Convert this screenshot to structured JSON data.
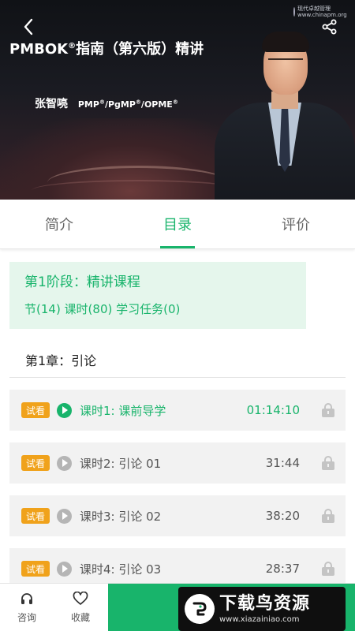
{
  "hero": {
    "title_main": "PMBOK",
    "title_sup": "®",
    "title_rest": "指南（第六版）精讲",
    "author_name": "张智喨",
    "author_creds": [
      {
        "text": "PMP",
        "sup": "®"
      },
      {
        "text": "/PgMP",
        "sup": "®"
      },
      {
        "text": "/OPME",
        "sup": "®"
      }
    ],
    "logo_line1": "现代卓越管理",
    "logo_line2": "www.chinapm.org"
  },
  "tabs": [
    {
      "label": "简介",
      "active": false
    },
    {
      "label": "目录",
      "active": true
    },
    {
      "label": "评价",
      "active": false
    }
  ],
  "stage": {
    "title": "第1阶段：精讲课程",
    "meta": "节(14) 课时(80) 学习任务(0)"
  },
  "chapter": {
    "title": "第1章：引论"
  },
  "lessons": [
    {
      "badge": "试看",
      "name": "课时1: 课前导学",
      "duration": "01:14:10",
      "active": true
    },
    {
      "badge": "试看",
      "name": "课时2: 引论 01",
      "duration": "31:44",
      "active": false
    },
    {
      "badge": "试看",
      "name": "课时3: 引论 02",
      "duration": "38:20",
      "active": false
    },
    {
      "badge": "试看",
      "name": "课时4: 引论 03",
      "duration": "28:37",
      "active": false
    }
  ],
  "bottom": {
    "consult_label": "咨询",
    "favorite_label": "收藏"
  },
  "watermark": {
    "big": "下载鸟资源",
    "small": "www.xiazainiao.com"
  },
  "colors": {
    "accent": "#18b46b",
    "badge": "#f0a21b",
    "stage_bg": "#e5f6ec",
    "lesson_bg": "#f2f2f2"
  }
}
